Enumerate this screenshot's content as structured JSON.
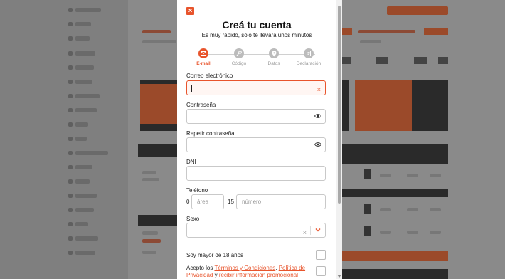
{
  "modal": {
    "close_icon": "×",
    "title": "Creá tu cuenta",
    "subtitle": "Es muy rápido, solo te llevará unos minutos"
  },
  "steps": [
    {
      "label": "E-mail",
      "icon": "mail-icon",
      "active": true
    },
    {
      "label": "Código",
      "icon": "key-icon",
      "active": false
    },
    {
      "label": "Datos",
      "icon": "location-pin-icon",
      "active": false
    },
    {
      "label": "Declaración",
      "icon": "document-icon",
      "active": false
    }
  ],
  "form": {
    "email_label": "Correo electrónico",
    "email_value": "",
    "email_clear": "×",
    "password_label": "Contraseña",
    "repeat_password_label": "Repetir contraseña",
    "dni_label": "DNI",
    "phone_label": "Teléfono",
    "phone_prefix": "0",
    "phone_area_placeholder": "área",
    "phone_mid_prefix": "15",
    "phone_number_placeholder": "número",
    "sex_label": "Sexo",
    "sex_clear": "×",
    "adult_label": "Soy mayor de 18 años",
    "terms_prefix": "Acepto los ",
    "terms_link": "Términos y Condiciones",
    "terms_sep": ", ",
    "privacy_link": "Política de Privacidad",
    "terms_and": " y ",
    "promo_link": "recibir información promocional"
  },
  "colors": {
    "accent": "#e8542c",
    "overlay": "#8a8a8a"
  }
}
